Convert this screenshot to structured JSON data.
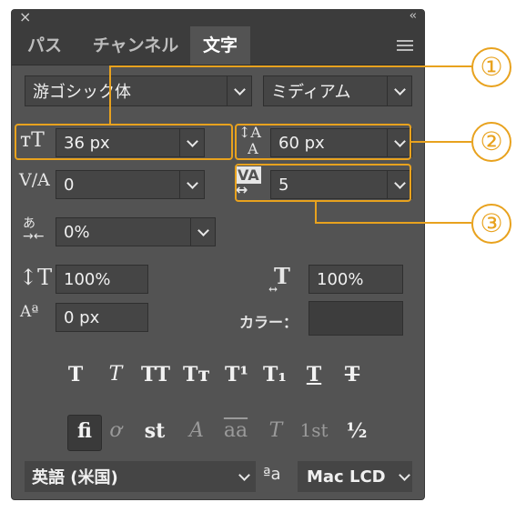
{
  "panel": {
    "tabs": [
      {
        "label": "パス"
      },
      {
        "label": "チャンネル"
      },
      {
        "label": "文字"
      }
    ]
  },
  "font": {
    "family": "游ゴシック体",
    "style": "ミディアム"
  },
  "size": {
    "font_size": "36 px",
    "leading": "60 px",
    "kerning": "0",
    "tracking": "5",
    "tsume": "0%",
    "vertical_scale": "100%",
    "horizontal_scale": "100%",
    "baseline_shift": "0 px"
  },
  "color": {
    "label": "カラー：",
    "swatch": "#3d3d3d"
  },
  "styles": {
    "row1": [
      "T",
      "T",
      "TT",
      "Tт",
      "T¹",
      "T₁",
      "T",
      "T"
    ],
    "row2": [
      "fi",
      "ơ",
      "st",
      "A",
      "aa",
      "T",
      "1st",
      "½"
    ]
  },
  "bottom": {
    "language": "英語 (米国)",
    "aa_icon": "ªa",
    "aa_method": "Mac LCD"
  },
  "callouts": [
    "①",
    "②",
    "③"
  ],
  "accent_color": "#e8a21e"
}
